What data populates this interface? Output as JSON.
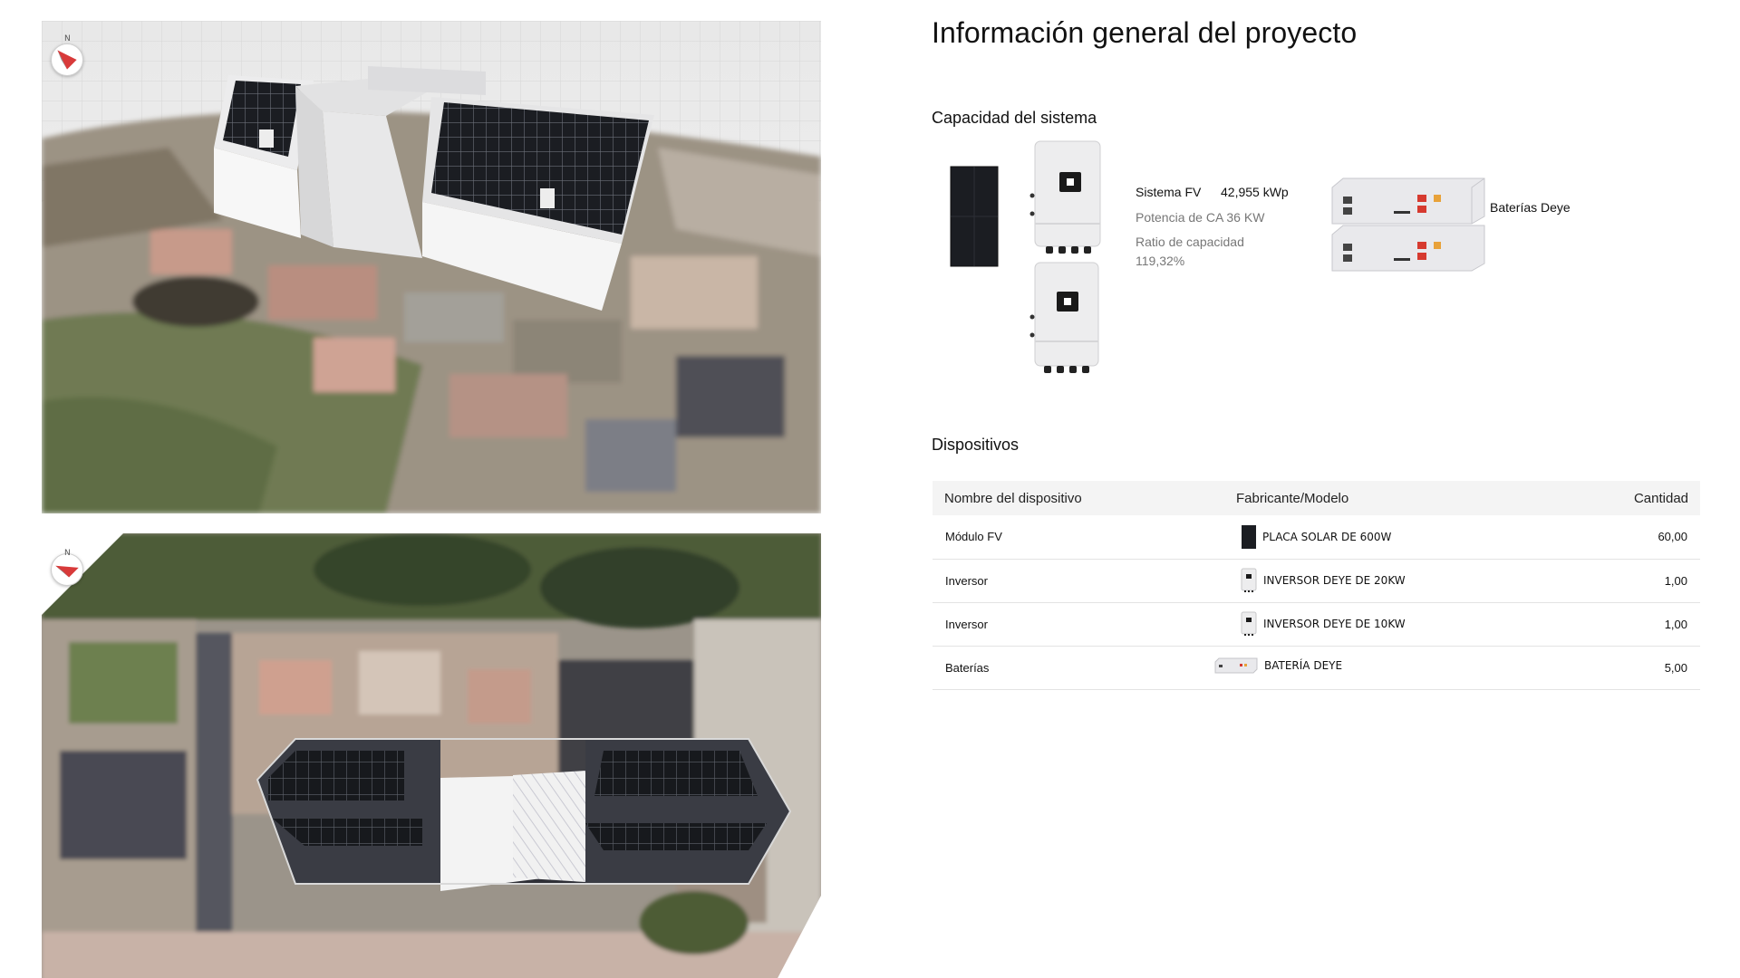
{
  "page": {
    "title": "Información general del proyecto"
  },
  "maps": {
    "compass_label": "N"
  },
  "capacity": {
    "section_title": "Capacidad del sistema",
    "fv_label": "Sistema FV",
    "fv_value": "42,955 kWp",
    "ac_power": "Potencia de CA 36 KW",
    "ratio_label": "Ratio de capacidad",
    "ratio_value": "119,32%",
    "battery_label": "Baterías Deye",
    "icons": [
      "solar-panel-icon",
      "inverter-icon",
      "battery-icon"
    ]
  },
  "devices": {
    "section_title": "Dispositivos",
    "columns": [
      "Nombre del dispositivo",
      "Fabricante/Modelo",
      "Cantidad"
    ],
    "rows": [
      {
        "name": "Módulo  FV",
        "model": "PLACA SOLAR DE 600W",
        "qty": "60,00",
        "icon": "solar-panel-icon"
      },
      {
        "name": "Inversor",
        "model": "INVERSOR DEYE DE 20KW",
        "qty": "1,00",
        "icon": "inverter-icon"
      },
      {
        "name": "Inversor",
        "model": "INVERSOR DEYE DE 10KW",
        "qty": "1,00",
        "icon": "inverter-icon"
      },
      {
        "name": "Baterías",
        "model": "BATERÍA DEYE",
        "qty": "5,00",
        "icon": "battery-icon"
      }
    ]
  },
  "colors": {
    "panel": "#1b1d22",
    "building": "#e9e9ea",
    "table_header": "#f4f4f4",
    "battery_red": "#d63a2f",
    "compass_red": "#d83a3a"
  }
}
